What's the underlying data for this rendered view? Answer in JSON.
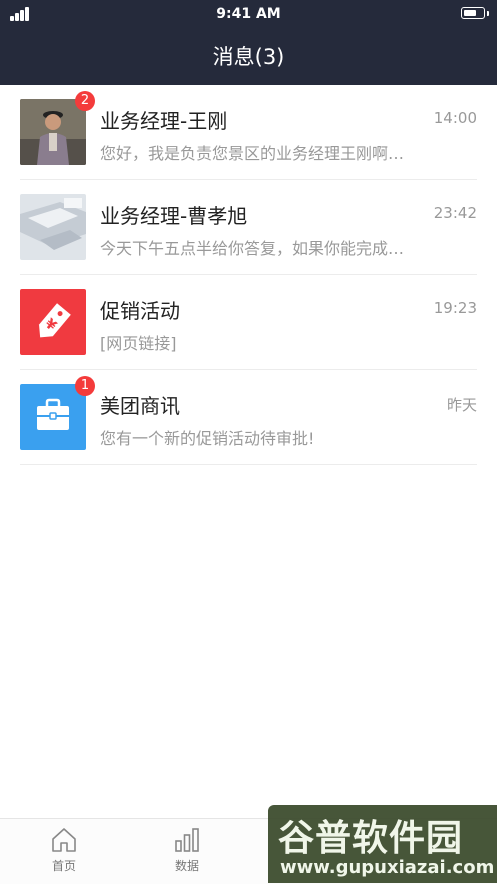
{
  "status_bar": {
    "time": "9:41 AM"
  },
  "header": {
    "title": "消息(3)"
  },
  "messages": [
    {
      "name": "业务经理-王刚",
      "time": "14:00",
      "preview": "您好，我是负责您景区的业务经理王刚啊…",
      "badge": "2",
      "avatar_icon": "person-photo"
    },
    {
      "name": "业务经理-曹孝旭",
      "time": "23:42",
      "preview": "今天下午五点半给你答复，如果你能完成…",
      "avatar_icon": "desk-photo"
    },
    {
      "name": "促销活动",
      "time": "19:23",
      "preview": "[网页链接]",
      "avatar_icon": "price-tag-icon",
      "avatar_color": "#f03a40"
    },
    {
      "name": "美团商讯",
      "time": "昨天",
      "preview": "您有一个新的促销活动待审批!",
      "badge": "1",
      "avatar_icon": "briefcase-icon",
      "avatar_color": "#3aa0ef"
    }
  ],
  "tab_bar": {
    "tabs": [
      {
        "label": "首页",
        "icon": "home-icon"
      },
      {
        "label": "数据",
        "icon": "bar-chart-icon"
      }
    ]
  },
  "watermark": {
    "text_cn": "谷普软件园",
    "url": "www.gupuxiazai.com"
  }
}
